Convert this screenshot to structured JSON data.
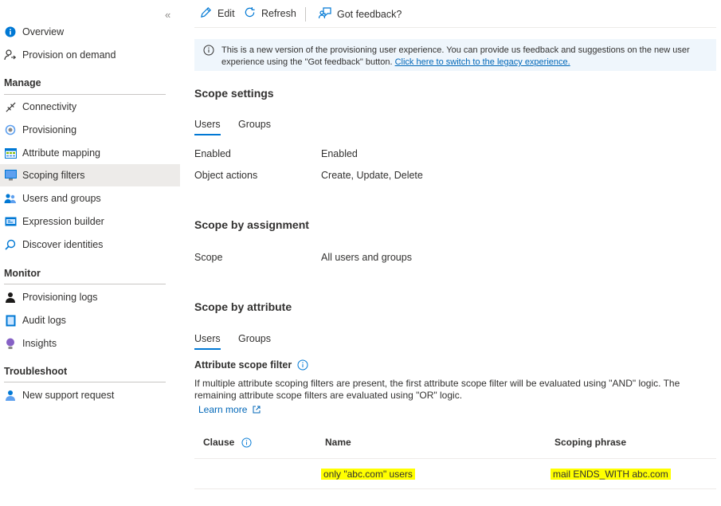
{
  "sidebar": {
    "collapse_icon": "«",
    "items_top": [
      {
        "label": "Overview",
        "icon": "info-icon"
      },
      {
        "label": "Provision on demand",
        "icon": "user-sync-icon"
      }
    ],
    "sections": [
      {
        "title": "Manage",
        "items": [
          {
            "label": "Connectivity",
            "icon": "connection-icon"
          },
          {
            "label": "Provisioning",
            "icon": "provisioning-icon"
          },
          {
            "label": "Attribute mapping",
            "icon": "attribute-mapping-icon"
          },
          {
            "label": "Scoping filters",
            "icon": "scoping-filters-icon",
            "selected": true
          },
          {
            "label": "Users and groups",
            "icon": "users-groups-icon"
          },
          {
            "label": "Expression builder",
            "icon": "expression-builder-icon"
          },
          {
            "label": "Discover identities",
            "icon": "search-icon"
          }
        ]
      },
      {
        "title": "Monitor",
        "items": [
          {
            "label": "Provisioning logs",
            "icon": "logs-icon"
          },
          {
            "label": "Audit logs",
            "icon": "audit-logs-icon"
          },
          {
            "label": "Insights",
            "icon": "insights-icon"
          }
        ]
      },
      {
        "title": "Troubleshoot",
        "items": [
          {
            "label": "New support request",
            "icon": "support-request-icon"
          }
        ]
      }
    ]
  },
  "toolbar": {
    "edit_label": "Edit",
    "refresh_label": "Refresh",
    "feedback_label": "Got feedback?"
  },
  "banner": {
    "text": "This is a new version of the provisioning user experience. You can provide us feedback and suggestions on the new user experience using the \"Got feedback\" button.",
    "link": "Click here to switch to the legacy experience."
  },
  "scope_settings": {
    "title": "Scope settings",
    "tabs": [
      "Users",
      "Groups"
    ],
    "rows": [
      {
        "key": "Enabled",
        "value": "Enabled"
      },
      {
        "key": "Object actions",
        "value": "Create, Update, Delete"
      }
    ]
  },
  "scope_by_assignment": {
    "title": "Scope by assignment",
    "rows": [
      {
        "key": "Scope",
        "value": "All users and groups"
      }
    ]
  },
  "scope_by_attribute": {
    "title": "Scope by attribute",
    "tabs": [
      "Users",
      "Groups"
    ],
    "filter_title": "Attribute scope filter",
    "description": "If multiple attribute scoping filters are present, the first attribute scope filter will be evaluated using \"AND\" logic. The remaining attribute scope filters are evaluated using \"OR\" logic.",
    "learn_more": "Learn more",
    "table": {
      "columns": [
        "Clause",
        "Name",
        "Scoping phrase"
      ],
      "rows": [
        {
          "clause": "",
          "name": "only \"abc.com\" users",
          "phrase": "mail ENDS_WITH abc.com"
        }
      ]
    }
  },
  "colors": {
    "accent": "#0078d4",
    "highlight": "#ffff00",
    "selected_bg": "#edebe9"
  }
}
